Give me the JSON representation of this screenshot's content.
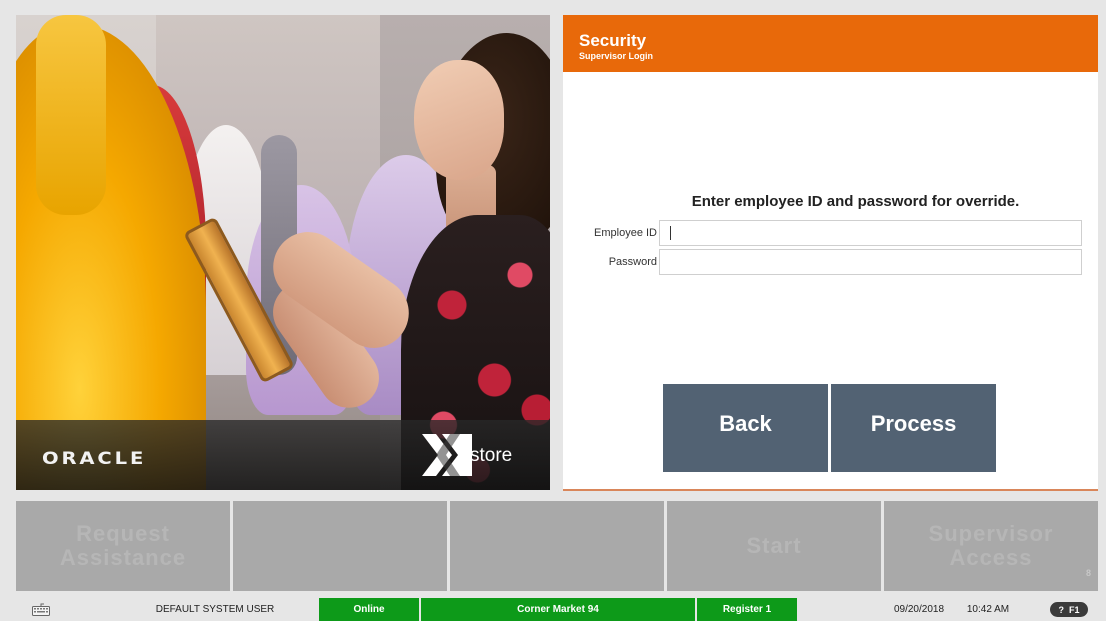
{
  "hero": {
    "brand_left": "ORACLE",
    "brand_right": "store",
    "brand_right_icon": "x-logo-icon"
  },
  "panel": {
    "title": "Security",
    "subtitle": "Supervisor Login",
    "header_color": "#e8690a",
    "prompt": "Enter employee ID and password for override.",
    "fields": [
      {
        "label": "Employee ID",
        "value": "",
        "placeholder": ""
      },
      {
        "label": "Password",
        "value": "",
        "placeholder": ""
      }
    ],
    "buttons": {
      "back": "Back",
      "process": "Process"
    },
    "button_color": "#526273"
  },
  "menu": {
    "items": [
      {
        "label": "Request Assistance",
        "enabled": false
      },
      {
        "label": "",
        "enabled": false
      },
      {
        "label": "",
        "enabled": false
      },
      {
        "label": "Start",
        "enabled": false
      },
      {
        "label": "Supervisor Access",
        "enabled": false
      }
    ],
    "scroll_marker": "8"
  },
  "status_bar": {
    "keyboard_icon": "keyboard-icon",
    "user": "DEFAULT SYSTEM USER",
    "connection": "Online",
    "store": "Corner Market 94",
    "register": "Register 1",
    "date": "09/20/2018",
    "time": "10:42 AM",
    "help_label": "?",
    "help_key": "F1",
    "status_color": "#0d9a19"
  }
}
